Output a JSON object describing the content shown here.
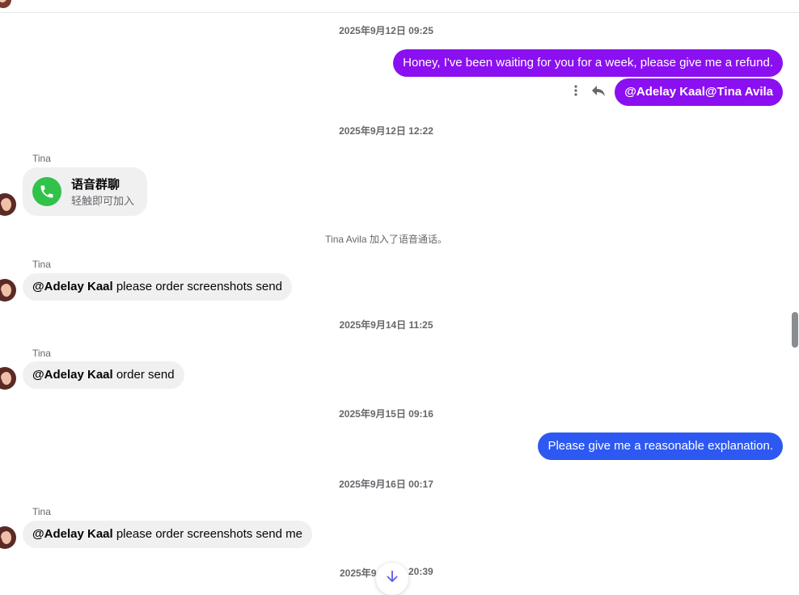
{
  "messages": {
    "ts1": "2025年9月12日 09:25",
    "out1": "Honey, I've been waiting for you for a week, please give me a refund.",
    "out2": "@Adelay Kaal@Tina Avila",
    "ts2": "2025年9月12日 12:22",
    "sender1": "Tina",
    "call_title": "语音群聊",
    "call_sub": "轻触即可加入",
    "sys1": "Tina Avila 加入了语音通话。",
    "sender2": "Tina",
    "in2_mention": "@Adelay Kaal",
    "in2_text": " please order screenshots send",
    "ts3": "2025年9月14日 11:25",
    "sender3": "Tina",
    "in3_mention": "@Adelay Kaal",
    "in3_text": " order send",
    "ts4": "2025年9月15日 09:16",
    "out3": "Please give me a reasonable explanation.",
    "ts5": "2025年9月16日 00:17",
    "sender4": "Tina",
    "in4_mention": "@Adelay Kaal",
    "in4_text": " please order screenshots send me",
    "ts6_left": "2025年9",
    "ts6_right": "20:39"
  },
  "icons": {
    "more": "more-vertical-icon",
    "reply": "reply-icon",
    "react": "smiley-icon",
    "call": "phone-icon",
    "scroll_down": "arrow-down-icon"
  },
  "colors": {
    "purple_bubble": "#8b10f1",
    "blue_bubble": "#2d59f2",
    "incoming_bubble": "#f0f0f0",
    "call_green": "#31c24a"
  }
}
